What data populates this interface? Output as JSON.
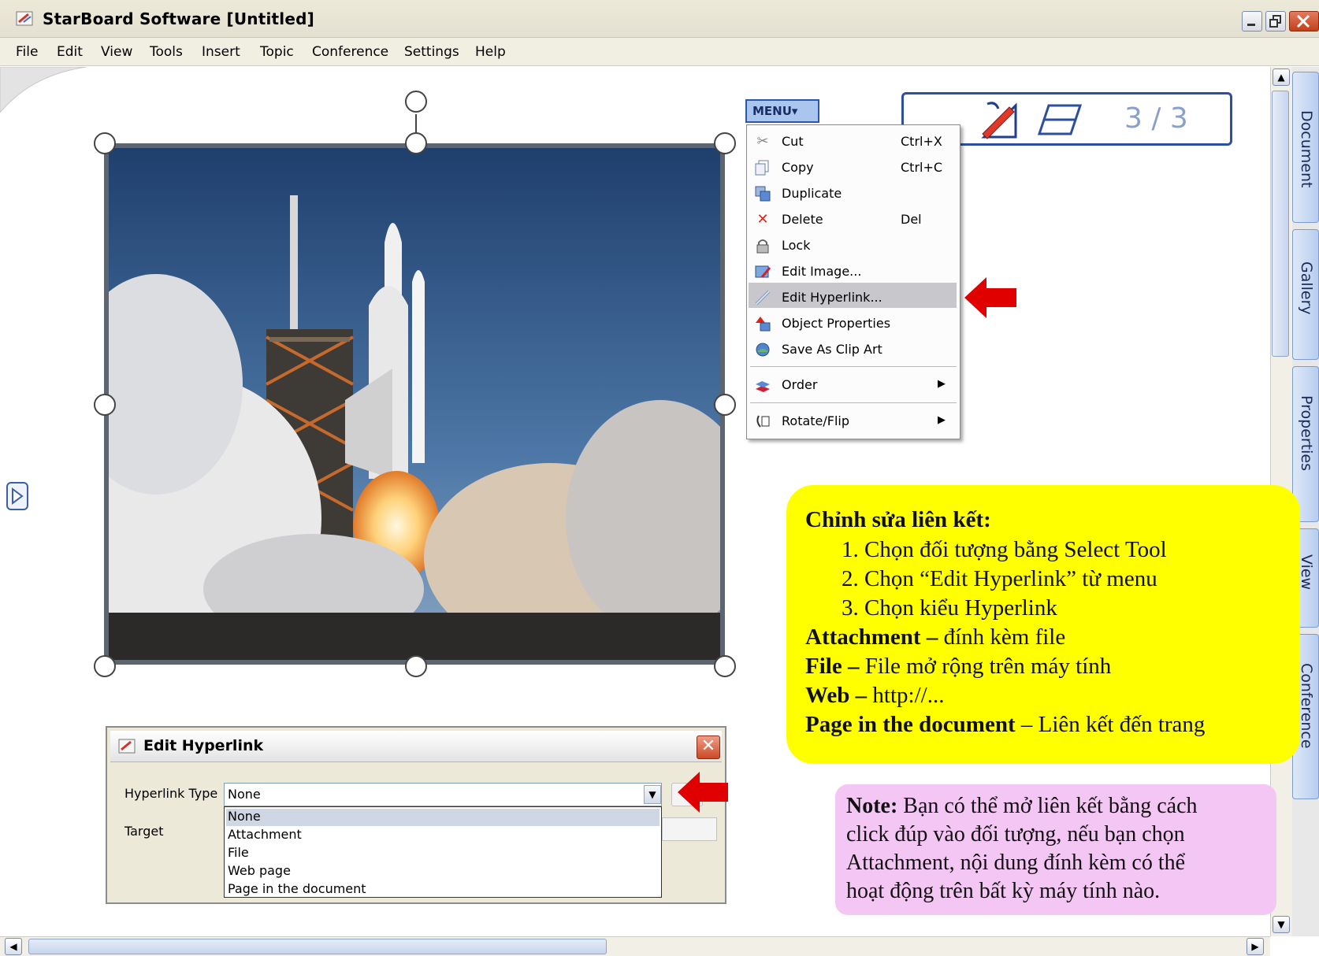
{
  "window": {
    "title": "StarBoard Software [Untitled]"
  },
  "menubar": {
    "items": [
      "File",
      "Edit",
      "View",
      "Tools",
      "Insert",
      "Topic",
      "Conference",
      "Settings",
      "Help"
    ]
  },
  "toolbar_float": {
    "menu_label": "MENU▾",
    "page_count": "3 / 3"
  },
  "context_menu": {
    "items": [
      {
        "label": "Cut",
        "shortcut": "Ctrl+X",
        "icon": "scissors-icon"
      },
      {
        "label": "Copy",
        "shortcut": "Ctrl+C",
        "icon": "copy-icon"
      },
      {
        "label": "Duplicate",
        "shortcut": "",
        "icon": "duplicate-icon"
      },
      {
        "label": "Delete",
        "shortcut": "Del",
        "icon": "delete-x-icon"
      },
      {
        "label": "Lock",
        "shortcut": "",
        "icon": "lock-icon"
      },
      {
        "label": "Edit Image...",
        "shortcut": "",
        "icon": "edit-image-icon"
      },
      {
        "label": "Edit Hyperlink...",
        "shortcut": "",
        "icon": "hyperlink-icon"
      },
      {
        "label": "Object Properties",
        "shortcut": "",
        "icon": "properties-icon"
      },
      {
        "label": "Save As Clip Art",
        "shortcut": "",
        "icon": "clipart-icon"
      },
      {
        "label": "Order",
        "shortcut": "",
        "icon": "order-icon"
      },
      {
        "label": "Rotate/Flip",
        "shortcut": "",
        "icon": "rotate-icon"
      }
    ],
    "highlighted": "Edit Hyperlink..."
  },
  "side_tabs": [
    "Document",
    "Gallery",
    "Properties",
    "View",
    "Conference"
  ],
  "dialog": {
    "title": "Edit Hyperlink",
    "type_label": "Hyperlink Type",
    "type_value": "None",
    "target_label": "Target",
    "options": [
      "None",
      "Attachment",
      "File",
      "Web page",
      "Page in the document"
    ]
  },
  "annotation": {
    "heading": "Chỉnh sửa liên kết:",
    "steps": [
      "1.  Chọn đối tượng bằng Select Tool",
      "2.  Chọn “Edit Hyperlink” từ menu",
      "3.  Chọn kiểu Hyperlink"
    ],
    "types": [
      {
        "term": "Attachment –",
        "desc": " đính kèm file"
      },
      {
        "term": "File –",
        "desc": " File mở rộng trên máy tính"
      },
      {
        "term": "Web –",
        "desc": " http://..."
      },
      {
        "term": "Page in the document",
        "desc": " – Liên kết đến trang"
      }
    ]
  },
  "note": {
    "term": "Note:",
    "lines": [
      " Bạn có thể mở liên kết bằng cách",
      "click đúp vào đối tượng, nếu bạn chọn",
      "Attachment, nội dung đính kèm có thể",
      "hoạt động trên bất kỳ máy tính nào."
    ]
  },
  "colors": {
    "annotation_bg": "#ffff00",
    "note_bg": "#f4c6f4",
    "arrow": "#e00000",
    "highlight": "#c8c8cc"
  }
}
